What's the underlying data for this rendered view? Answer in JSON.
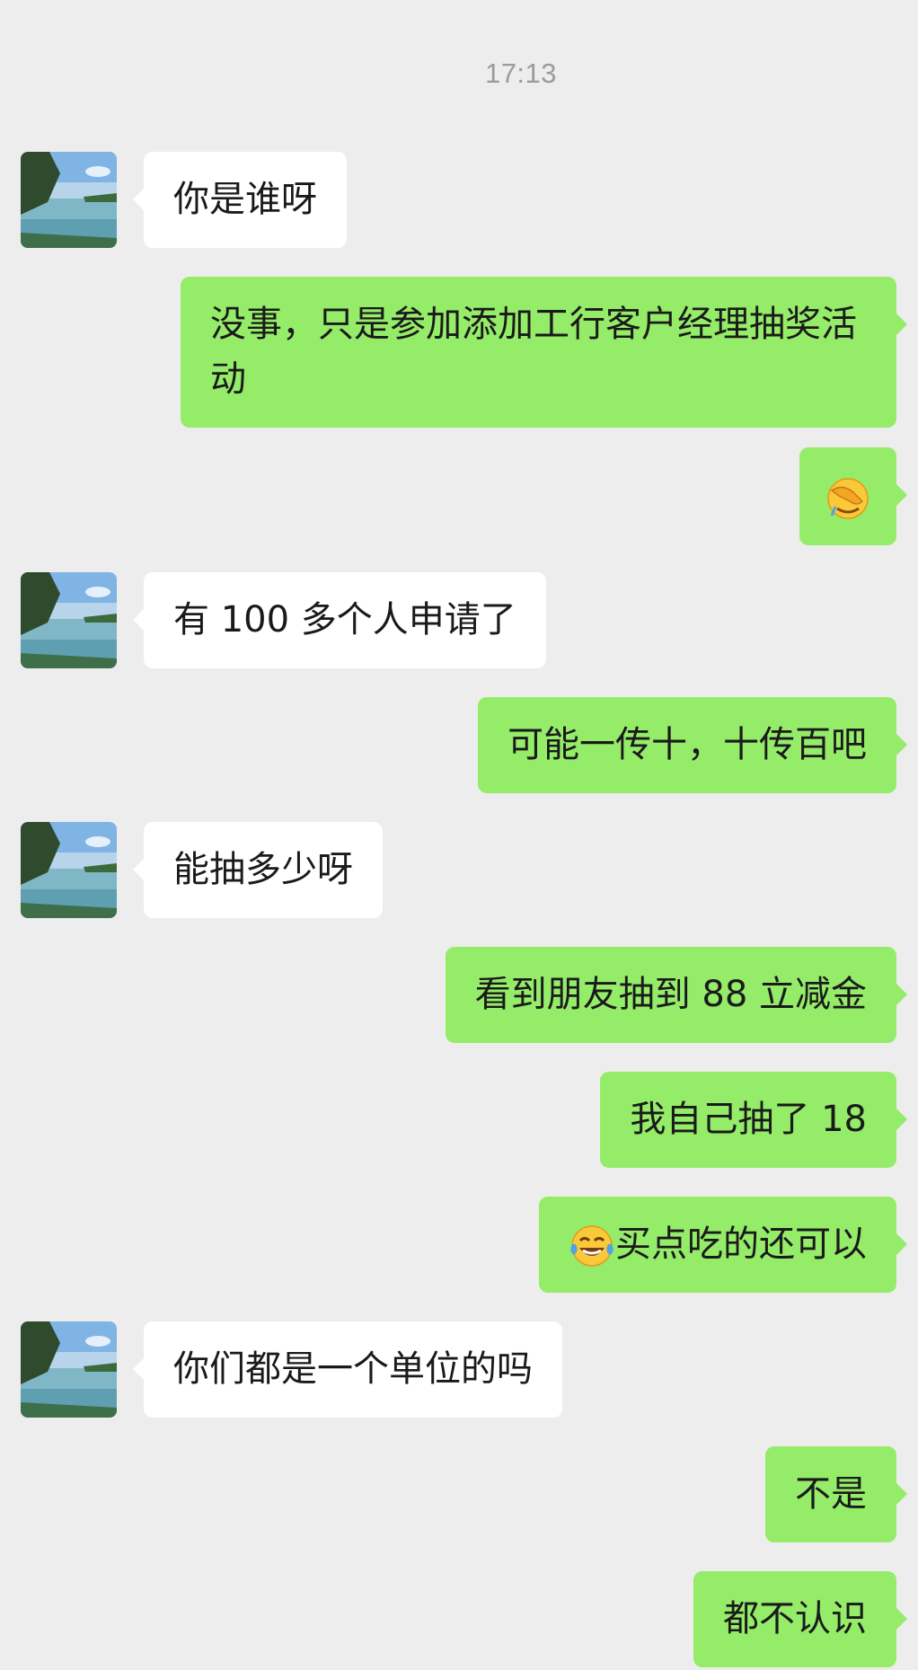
{
  "chat": {
    "timestamp": "17:13",
    "messages": [
      {
        "side": "in",
        "text": "你是谁呀"
      },
      {
        "side": "out",
        "text": "没事，只是参加添加工行客户经理抽奖活动"
      },
      {
        "side": "out",
        "emoji": "facepalm-emoji"
      },
      {
        "side": "in",
        "text": "有 100 多个人申请了"
      },
      {
        "side": "out",
        "text": "可能一传十，十传百吧"
      },
      {
        "side": "in",
        "text": "能抽多少呀"
      },
      {
        "side": "out",
        "text": "看到朋友抽到 88 立减金"
      },
      {
        "side": "out",
        "text": "我自己抽了 18"
      },
      {
        "side": "out",
        "emoji": "tears-of-joy-emoji",
        "text": "买点吃的还可以"
      },
      {
        "side": "in",
        "text": "你们都是一个单位的吗"
      },
      {
        "side": "out",
        "text": "不是"
      },
      {
        "side": "out",
        "text": "都不认识"
      }
    ]
  },
  "colors": {
    "background": "#ededed",
    "outgoing_bubble": "#95ec69",
    "incoming_bubble": "#ffffff",
    "timestamp_text": "#9b9b9b"
  }
}
